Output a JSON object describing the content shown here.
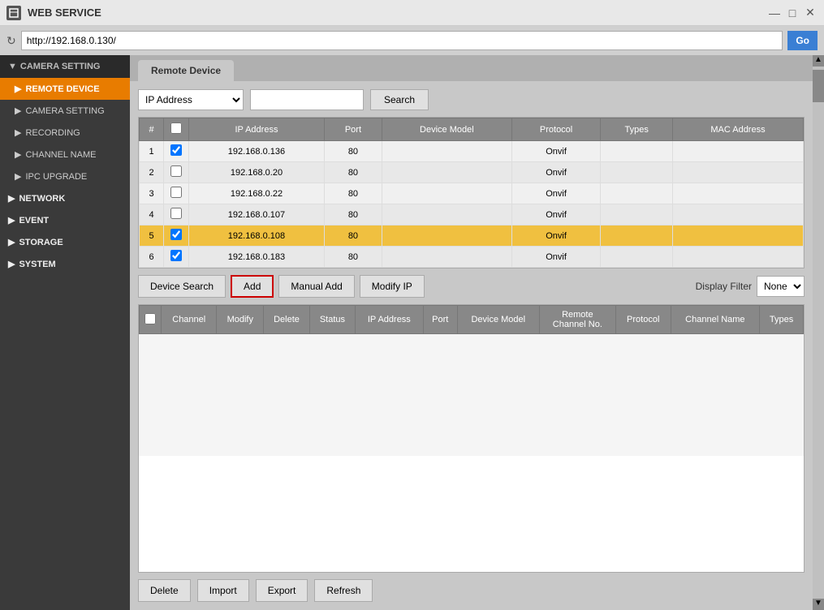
{
  "titlebar": {
    "title": "WEB SERVICE",
    "min_btn": "—",
    "max_btn": "□",
    "close_btn": "✕"
  },
  "addressbar": {
    "url": "http://192.168.0.130/",
    "go_label": "Go"
  },
  "sidebar": {
    "section_label": "CAMERA SETTING",
    "items": [
      {
        "id": "remote-device",
        "label": "REMOTE DEVICE",
        "active": true,
        "indent": false
      },
      {
        "id": "camera-setting",
        "label": "CAMERA SETTING",
        "active": false,
        "indent": true
      },
      {
        "id": "recording",
        "label": "RECORDING",
        "active": false,
        "indent": true
      },
      {
        "id": "channel-name",
        "label": "CHANNEL NAME",
        "active": false,
        "indent": true
      },
      {
        "id": "ipc-upgrade",
        "label": "IPC UPGRADE",
        "active": false,
        "indent": true
      },
      {
        "id": "network",
        "label": "NETWORK",
        "active": false,
        "indent": false
      },
      {
        "id": "event",
        "label": "EVENT",
        "active": false,
        "indent": false
      },
      {
        "id": "storage",
        "label": "STORAGE",
        "active": false,
        "indent": false
      },
      {
        "id": "system",
        "label": "SYSTEM",
        "active": false,
        "indent": false
      }
    ]
  },
  "tab": {
    "label": "Remote Device"
  },
  "filter": {
    "type_options": [
      "IP Address"
    ],
    "type_selected": "IP Address",
    "search_label": "Search"
  },
  "device_table": {
    "columns": [
      "#",
      "",
      "IP Address",
      "Port",
      "Device Model",
      "Protocol",
      "Types",
      "MAC Address"
    ],
    "rows": [
      {
        "num": 1,
        "checked": true,
        "ip": "192.168.0.136",
        "port": 80,
        "model": "",
        "protocol": "Onvif",
        "types": "",
        "mac": "",
        "selected": false
      },
      {
        "num": 2,
        "checked": false,
        "ip": "192.168.0.20",
        "port": 80,
        "model": "",
        "protocol": "Onvif",
        "types": "",
        "mac": "",
        "selected": false
      },
      {
        "num": 3,
        "checked": false,
        "ip": "192.168.0.22",
        "port": 80,
        "model": "",
        "protocol": "Onvif",
        "types": "",
        "mac": "",
        "selected": false
      },
      {
        "num": 4,
        "checked": false,
        "ip": "192.168.0.107",
        "port": 80,
        "model": "",
        "protocol": "Onvif",
        "types": "",
        "mac": "",
        "selected": false
      },
      {
        "num": 5,
        "checked": true,
        "ip": "192.168.0.108",
        "port": 80,
        "model": "",
        "protocol": "Onvif",
        "types": "",
        "mac": "",
        "selected": true
      },
      {
        "num": 6,
        "checked": true,
        "ip": "192.168.0.183",
        "port": 80,
        "model": "",
        "protocol": "Onvif",
        "types": "",
        "mac": "",
        "selected": false
      }
    ]
  },
  "action_buttons": {
    "device_search": "Device Search",
    "add": "Add",
    "manual_add": "Manual Add",
    "modify_ip": "Modify IP",
    "display_filter_label": "Display Filter",
    "display_filter_options": [
      "None"
    ],
    "display_filter_selected": "None"
  },
  "channel_table": {
    "columns": [
      "",
      "Channel",
      "Modify",
      "Delete",
      "Status",
      "IP Address",
      "Port",
      "Device Model",
      "Remote Channel No.",
      "Protocol",
      "Channel Name",
      "Types"
    ]
  },
  "bottom_buttons": {
    "delete": "Delete",
    "import": "Import",
    "export": "Export",
    "refresh": "Refresh"
  }
}
